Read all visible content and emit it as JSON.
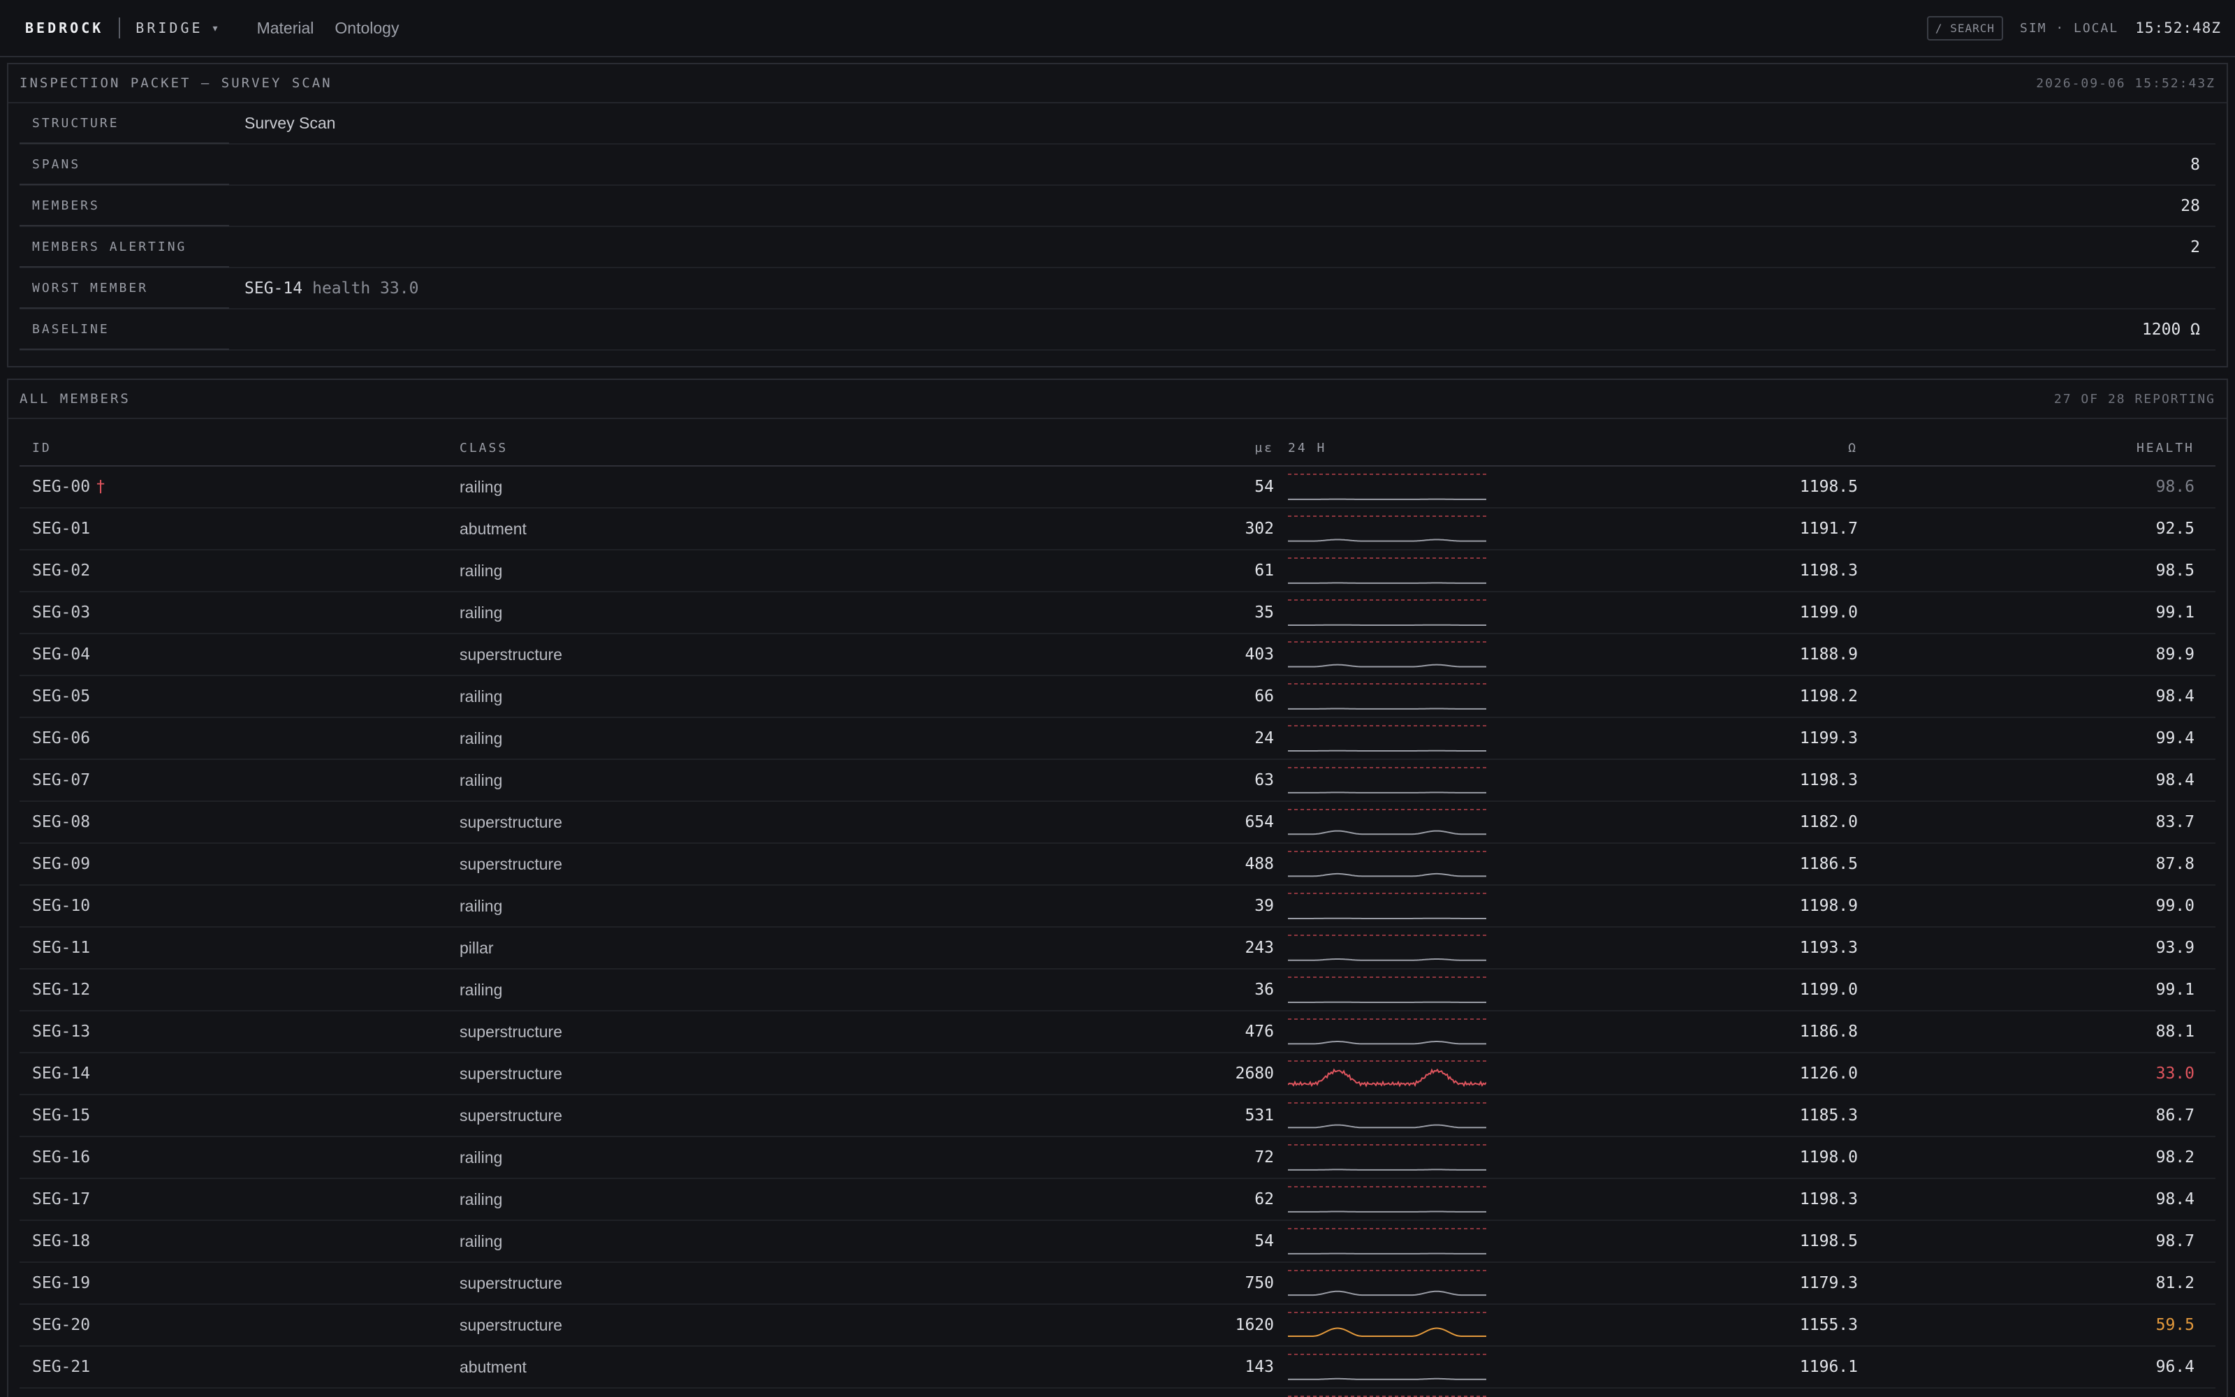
{
  "app": {
    "brand": "BEDROCK",
    "name": "BRIDGE",
    "caret": "▾",
    "nav": [
      "Material",
      "Ontology"
    ],
    "search": "/ SEARCH",
    "env": "SIM · LOCAL",
    "clock": "15:52:48Z"
  },
  "packet": {
    "title": "INSPECTION PACKET — SURVEY SCAN",
    "timestamp": "2026-09-06 15:52:43Z",
    "labels": {
      "structure": "STRUCTURE",
      "spans": "SPANS",
      "members": "MEMBERS",
      "alerting": "MEMBERS ALERTING",
      "worst": "WORST MEMBER",
      "baseline": "BASELINE"
    },
    "structure": "Survey Scan",
    "spans": "8",
    "members": "28",
    "alerting": "2",
    "worst_id": "SEG-14",
    "worst_health": "health 33.0",
    "baseline": "1200 Ω"
  },
  "members_panel": {
    "title": "ALL MEMBERS",
    "reporting": "27 OF 28 REPORTING",
    "columns": {
      "id": "ID",
      "class": "CLASS",
      "strain": "µε",
      "spark": "24 H",
      "ohm": "Ω",
      "health": "HEALTH"
    },
    "pin_glyph": "†",
    "rows": [
      {
        "id": "SEG-00",
        "class": "railing",
        "strain": "54",
        "ohm": "1198.5",
        "health": "98.6",
        "status": "dim",
        "pinned": true
      },
      {
        "id": "SEG-01",
        "class": "abutment",
        "strain": "302",
        "ohm": "1191.7",
        "health": "92.5",
        "status": "ok"
      },
      {
        "id": "SEG-02",
        "class": "railing",
        "strain": "61",
        "ohm": "1198.3",
        "health": "98.5",
        "status": "ok"
      },
      {
        "id": "SEG-03",
        "class": "railing",
        "strain": "35",
        "ohm": "1199.0",
        "health": "99.1",
        "status": "ok"
      },
      {
        "id": "SEG-04",
        "class": "superstructure",
        "strain": "403",
        "ohm": "1188.9",
        "health": "89.9",
        "status": "ok"
      },
      {
        "id": "SEG-05",
        "class": "railing",
        "strain": "66",
        "ohm": "1198.2",
        "health": "98.4",
        "status": "ok"
      },
      {
        "id": "SEG-06",
        "class": "railing",
        "strain": "24",
        "ohm": "1199.3",
        "health": "99.4",
        "status": "ok"
      },
      {
        "id": "SEG-07",
        "class": "railing",
        "strain": "63",
        "ohm": "1198.3",
        "health": "98.4",
        "status": "ok"
      },
      {
        "id": "SEG-08",
        "class": "superstructure",
        "strain": "654",
        "ohm": "1182.0",
        "health": "83.7",
        "status": "ok"
      },
      {
        "id": "SEG-09",
        "class": "superstructure",
        "strain": "488",
        "ohm": "1186.5",
        "health": "87.8",
        "status": "ok"
      },
      {
        "id": "SEG-10",
        "class": "railing",
        "strain": "39",
        "ohm": "1198.9",
        "health": "99.0",
        "status": "ok"
      },
      {
        "id": "SEG-11",
        "class": "pillar",
        "strain": "243",
        "ohm": "1193.3",
        "health": "93.9",
        "status": "ok"
      },
      {
        "id": "SEG-12",
        "class": "railing",
        "strain": "36",
        "ohm": "1199.0",
        "health": "99.1",
        "status": "ok"
      },
      {
        "id": "SEG-13",
        "class": "superstructure",
        "strain": "476",
        "ohm": "1186.8",
        "health": "88.1",
        "status": "ok"
      },
      {
        "id": "SEG-14",
        "class": "superstructure",
        "strain": "2680",
        "ohm": "1126.0",
        "health": "33.0",
        "status": "alert"
      },
      {
        "id": "SEG-15",
        "class": "superstructure",
        "strain": "531",
        "ohm": "1185.3",
        "health": "86.7",
        "status": "ok"
      },
      {
        "id": "SEG-16",
        "class": "railing",
        "strain": "72",
        "ohm": "1198.0",
        "health": "98.2",
        "status": "ok"
      },
      {
        "id": "SEG-17",
        "class": "railing",
        "strain": "62",
        "ohm": "1198.3",
        "health": "98.4",
        "status": "ok"
      },
      {
        "id": "SEG-18",
        "class": "railing",
        "strain": "54",
        "ohm": "1198.5",
        "health": "98.7",
        "status": "ok"
      },
      {
        "id": "SEG-19",
        "class": "superstructure",
        "strain": "750",
        "ohm": "1179.3",
        "health": "81.2",
        "status": "ok"
      },
      {
        "id": "SEG-20",
        "class": "superstructure",
        "strain": "1620",
        "ohm": "1155.3",
        "health": "59.5",
        "status": "warn"
      },
      {
        "id": "SEG-21",
        "class": "abutment",
        "strain": "143",
        "ohm": "1196.1",
        "health": "96.4",
        "status": "ok"
      },
      {
        "id": "",
        "class": "",
        "strain": "",
        "ohm": "",
        "health": "",
        "status": "ok"
      }
    ]
  },
  "colors": {
    "background": "#111216",
    "alert": "#e0555e",
    "warn": "#e49a3c",
    "spark_normal": "#9a9da6",
    "threshold": "#b8434b"
  }
}
